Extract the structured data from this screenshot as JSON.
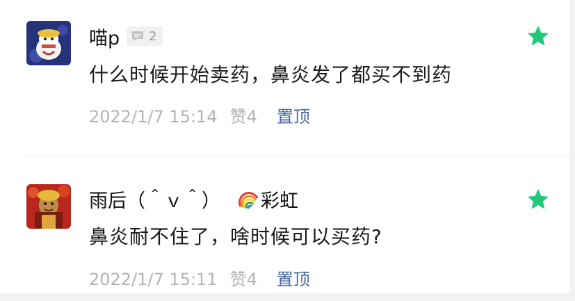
{
  "comments": [
    {
      "username": "喵p",
      "reply_count": "2",
      "content": "什么时候开始卖药，鼻炎发了都买不到药",
      "timestamp": "2022/1/7 15:14",
      "likes": "赞4",
      "pin_label": "置顶",
      "avatar_icon": "cartoon-avatar-icon",
      "star_color": "#22c87a"
    },
    {
      "username": "雨后（＾ｖ＾）",
      "badge_emoji": "rainbow-icon",
      "badge_text": "彩虹",
      "content": "鼻炎耐不住了，啥时候可以买药?",
      "timestamp": "2022/1/7 15:11",
      "likes": "赞4",
      "pin_label": "置顶",
      "avatar_icon": "photo-avatar-icon",
      "star_color": "#22c87a"
    }
  ]
}
